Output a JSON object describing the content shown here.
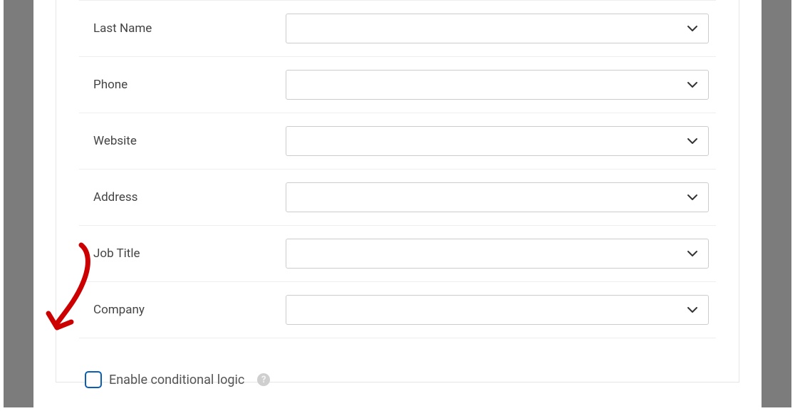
{
  "fields": [
    {
      "label": "Last Name",
      "value": ""
    },
    {
      "label": "Phone",
      "value": ""
    },
    {
      "label": "Website",
      "value": ""
    },
    {
      "label": "Address",
      "value": ""
    },
    {
      "label": "Job Title",
      "value": ""
    },
    {
      "label": "Company",
      "value": ""
    }
  ],
  "conditional": {
    "label": "Enable conditional logic",
    "checked": false,
    "help_glyph": "?"
  },
  "colors": {
    "checkbox_border": "#0a5fb3",
    "arrow": "#cc0000"
  }
}
